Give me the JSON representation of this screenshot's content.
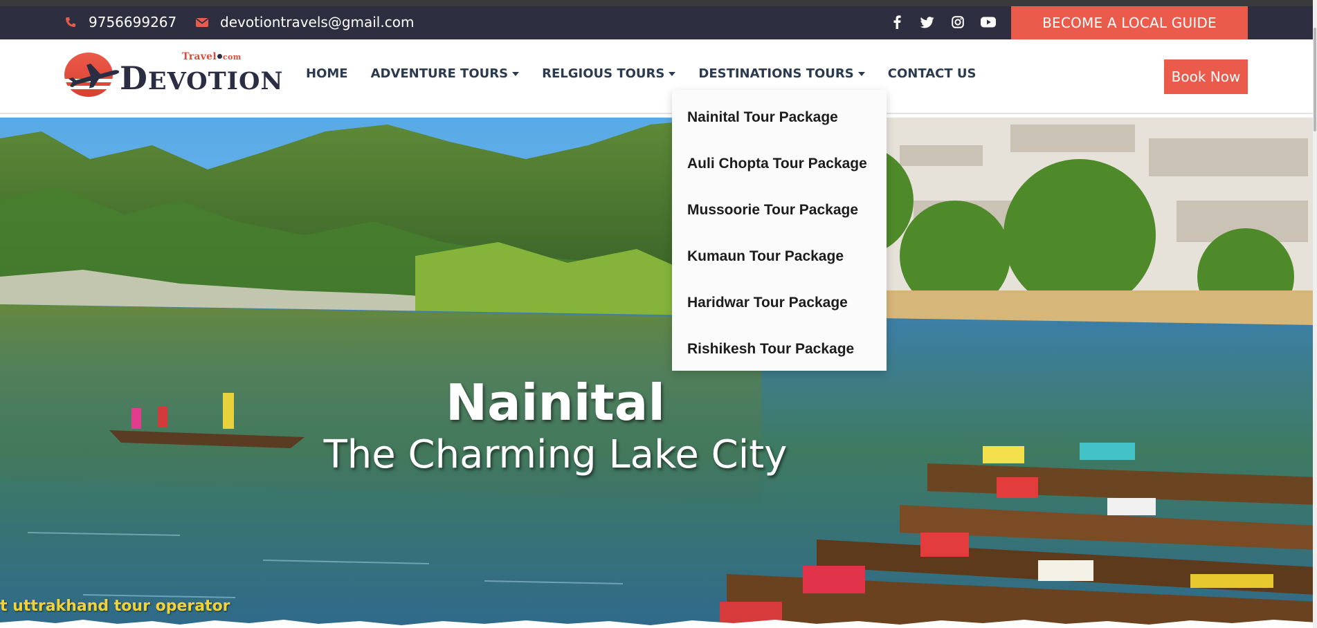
{
  "topbar": {
    "phone": "9756699267",
    "email": "devotiontravels@gmail.com",
    "socials": [
      "facebook-icon",
      "twitter-icon",
      "instagram-icon",
      "youtube-icon"
    ],
    "guide_button": "BECOME A LOCAL GUIDE"
  },
  "logo": {
    "travel": "Travel",
    "com": "com",
    "name_first": "D",
    "name_rest": "EVOTION"
  },
  "nav": {
    "items": [
      {
        "label": "HOME"
      },
      {
        "label": "ADVENTURE TOURS"
      },
      {
        "label": "RELGIOUS TOURS"
      },
      {
        "label": "DESTINATIONS TOURS"
      },
      {
        "label": "CONTACT US"
      }
    ],
    "book_button": "Book Now"
  },
  "dropdown": {
    "items": [
      "Nainital Tour Package",
      "Auli Chopta Tour Package",
      "Mussoorie Tour Package",
      "Kumaun Tour Package",
      "Haridwar Tour Package",
      "Rishikesh Tour Package"
    ]
  },
  "hero": {
    "title": "Nainital",
    "subtitle": "The Charming Lake City",
    "ticker": "t uttrakhand tour operator"
  },
  "colors": {
    "topbar": "#2d2e40",
    "accent": "#ea5b4c",
    "nav_text": "#2b3a4f"
  }
}
